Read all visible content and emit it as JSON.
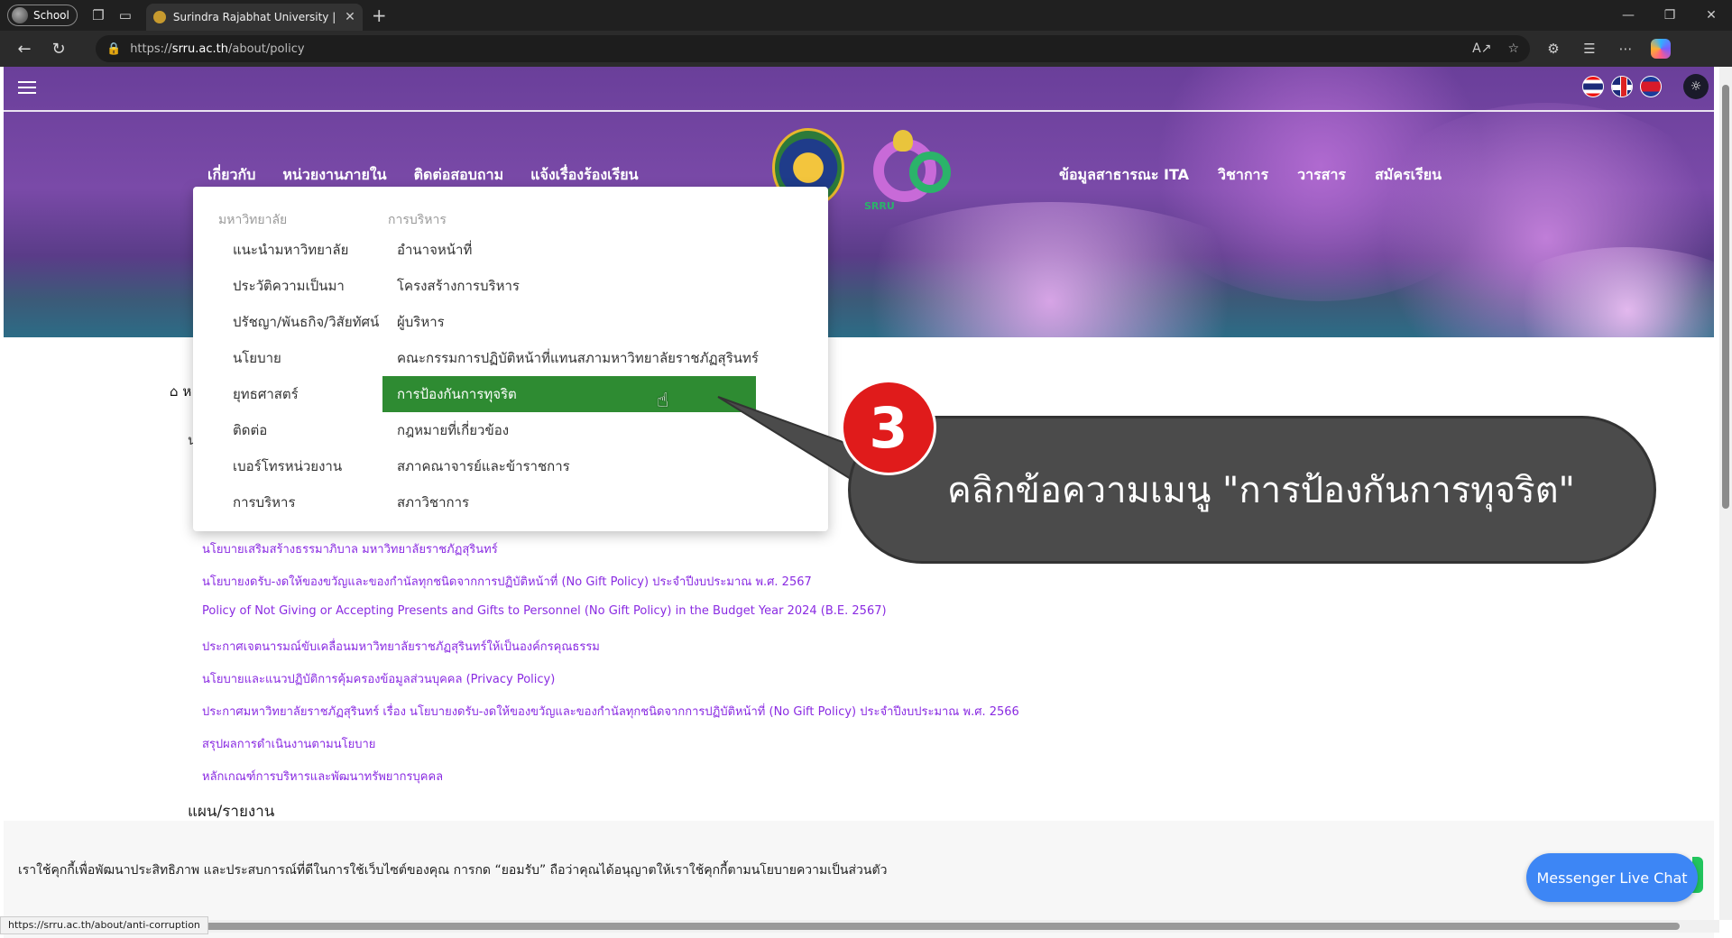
{
  "browser": {
    "profile_label": "School",
    "tab_title": "Surindra Rajabhat University | มห",
    "url_prefix": "https://",
    "url_domain": "srru.ac.th",
    "url_path": "/about/policy",
    "read_aloud_label": "A↗"
  },
  "site": {
    "nav_left": [
      "เกี่ยวกับ",
      "หน่วยงานภายใน",
      "ติดต่อสอบถาม",
      "แจ้งเรื่องร้องเรียน"
    ],
    "nav_right": [
      "ข้อมูลสาธารณะ ITA",
      "วิชาการ",
      "วารสาร",
      "สมัครเรียน"
    ],
    "logo_text": "SRRU"
  },
  "dropdown": {
    "col1_heading": "มหาวิทยาลัย",
    "col1_items": [
      "แนะนำมหาวิทยาลัย",
      "ประวัติความเป็นมา",
      "ปรัชญา/พันธกิจ/วิสัยทัศน์",
      "นโยบาย",
      "ยุทธศาสตร์",
      "ติดต่อ",
      "เบอร์โทรหน่วยงาน",
      "การบริหาร"
    ],
    "col2_heading": "การบริหาร",
    "col2_items": [
      "อำนาจหน้าที่",
      "โครงสร้างการบริหาร",
      "ผู้บริหาร",
      "คณะกรรมการปฏิบัติหน้าที่แทนสภามหาวิทยาลัยราชภัฏสุรินทร์",
      "การป้องกันการทุจริต",
      "กฎหมายที่เกี่ยวข้อง",
      "สภาคณาจารย์และข้าราชการ",
      "สภาวิชาการ"
    ]
  },
  "content": {
    "breadcrumb_initial": "ห",
    "section_initial": "น",
    "links": [
      "นโยบายเสริมสร้างธรรมาภิบาล มหาวิทยาลัยราชภัฏสุรินทร์",
      "นโยบายงดรับ-งดให้ของขวัญและของกำนัลทุกชนิดจากการปฏิบัติหน้าที่ (No Gift Policy) ประจำปีงบประมาณ พ.ศ. 2567",
      "Policy of Not Giving or Accepting Presents and Gifts to Personnel (No Gift Policy) in the Budget Year 2024 (B.E. 2567)",
      "ประกาศเจตนารมณ์ขับเคลื่อนมหาวิทยาลัยราชภัฏสุรินทร์ให้เป็นองค์กรคุณธรรม",
      "นโยบายและแนวปฏิบัติการคุ้มครองข้อมูลส่วนบุคคล (Privacy Policy)",
      "ประกาศมหาวิทยาลัยราชภัฏสุรินทร์ เรื่อง นโยบายงดรับ-งดให้ของขวัญและของกำนัลทุกชนิดจากการปฏิบัติหน้าที่ (No Gift Policy) ประจำปีงบประมาณ พ.ศ. 2566",
      "สรุปผลการดำเนินงานตามนโยบาย",
      "หลักเกณฑ์การบริหารและพัฒนาทรัพยากรบุคคล"
    ],
    "next_section": "แผน/รายงาน"
  },
  "annotation": {
    "step_number": "3",
    "instruction": "คลิกข้อความเมนู \"การป้องกันการทุจริต\""
  },
  "cookie": {
    "text": "เราใช้คุกกี้เพื่อพัฒนาประสิทธิภาพ และประสบการณ์ที่ดีในการใช้เว็บไซต์ของคุณ การกด “ยอมรับ” ถือว่าคุณได้อนุญาตให้เราใช้คุกกี้ตามนโยบายความเป็นส่วนตัว"
  },
  "chat": {
    "label": "Messenger Live Chat"
  },
  "status": {
    "hover_url": "https://srru.ac.th/about/anti-corruption"
  },
  "colors": {
    "menu_active": "#2e8b32",
    "link": "#8a2be2",
    "step_badge": "#e01b1b",
    "chat": "#3d86f5"
  }
}
